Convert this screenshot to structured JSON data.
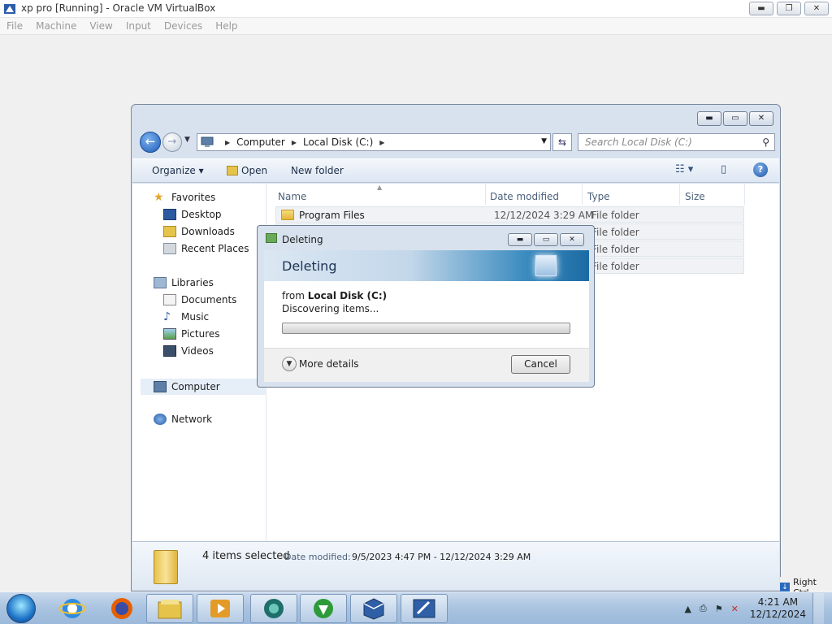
{
  "vbox": {
    "title": "xp pro [Running] - Oracle VM VirtualBox",
    "menu": [
      "File",
      "Machine",
      "View",
      "Input",
      "Devices",
      "Help"
    ],
    "window_buttons": {
      "minimize": "▬",
      "restore": "❐",
      "close": "✕"
    },
    "host_key": "Right Ctrl"
  },
  "explorer": {
    "breadcrumb": [
      "Computer",
      "Local Disk (C:)"
    ],
    "search_placeholder": "Search Local Disk (C:)",
    "commands": {
      "organize": "Organize",
      "open": "Open",
      "new_folder": "New folder"
    },
    "nav": {
      "favorites": "Favorites",
      "favorites_items": [
        "Desktop",
        "Downloads",
        "Recent Places"
      ],
      "libraries": "Libraries",
      "libraries_items": [
        "Documents",
        "Music",
        "Pictures",
        "Videos"
      ],
      "computer": "Computer",
      "network": "Network"
    },
    "columns": [
      "Name",
      "Date modified",
      "Type",
      "Size"
    ],
    "files": [
      {
        "name": "Program Files",
        "date": "12/12/2024 3:29 AM",
        "type": "File folder"
      },
      {
        "name": "",
        "date": "",
        "type": "File folder"
      },
      {
        "name": "",
        "date": "",
        "type": "File folder"
      },
      {
        "name": "",
        "date": "",
        "type": "File folder"
      }
    ],
    "details": {
      "count": "4 items selected",
      "date_label": "Date modified:",
      "date_value": "9/5/2023 4:47 PM - 12/12/2024 3:29 AM"
    }
  },
  "dialog": {
    "title": "Deleting",
    "banner": "Deleting",
    "from_prefix": "from",
    "from_location": "Local Disk (C:)",
    "status": "Discovering items...",
    "progress": 0,
    "more_details": "More details",
    "cancel": "Cancel"
  },
  "taskbar": {
    "time": "4:21 AM",
    "date": "12/12/2024"
  },
  "colors": {
    "accent": "#1c5cb8",
    "explorer_frame": "#d8e2ee",
    "taskbar": "#a9c3e0"
  }
}
